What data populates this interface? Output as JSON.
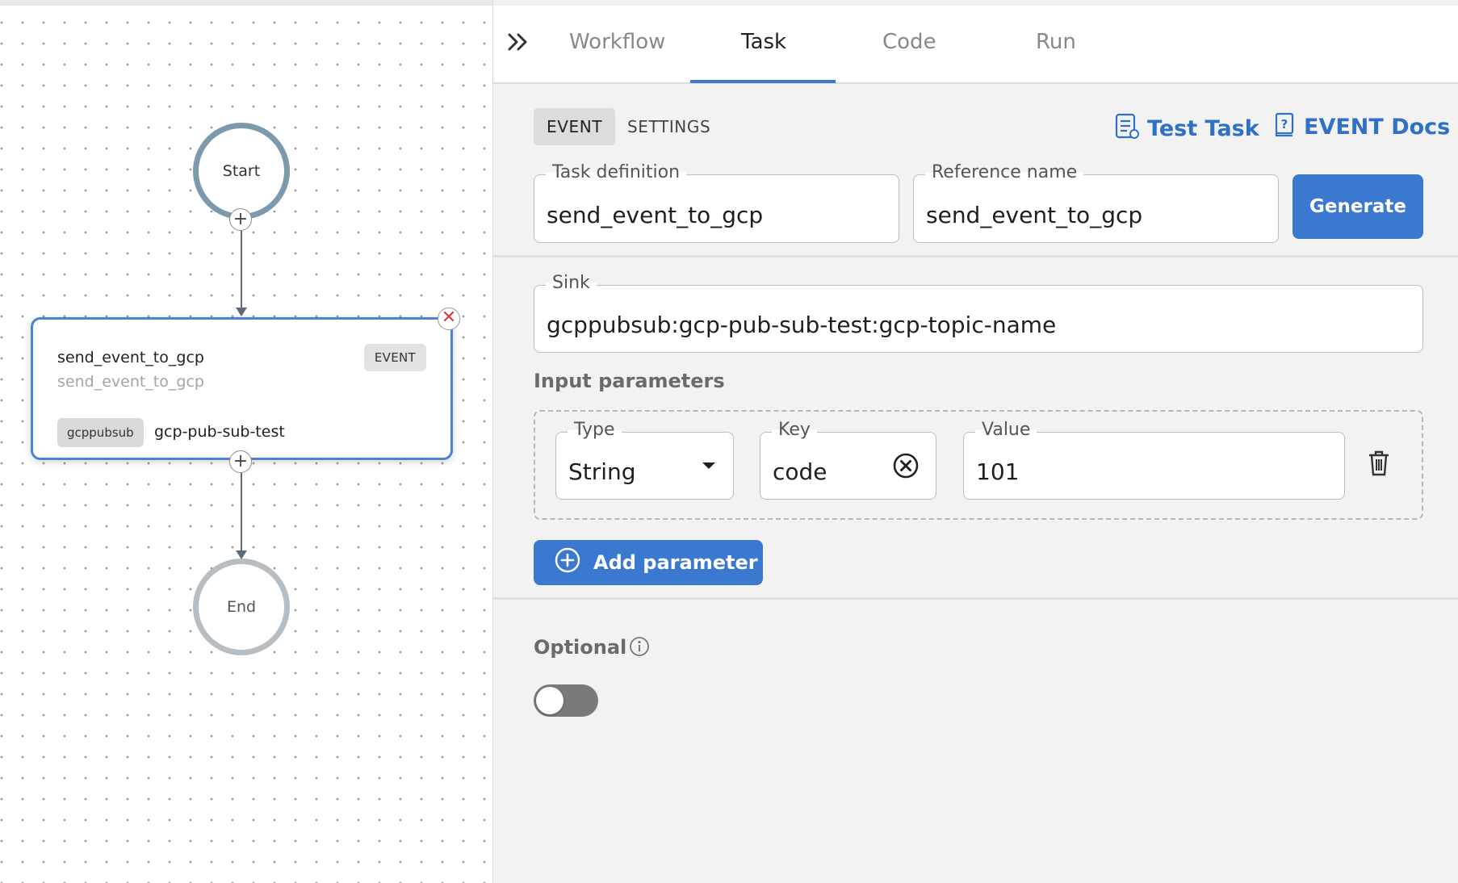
{
  "canvas": {
    "start_label": "Start",
    "end_label": "End",
    "task_node": {
      "name": "send_event_to_gcp",
      "reference": "send_event_to_gcp",
      "type_badge": "EVENT",
      "sink_chip": "gcppubsub",
      "sink_name": "gcp-pub-sub-test"
    },
    "plus_glyph": "+",
    "delete_glyph": "✕"
  },
  "panel": {
    "tabs": [
      {
        "label": "Workflow",
        "active": false
      },
      {
        "label": "Task",
        "active": true
      },
      {
        "label": "Code",
        "active": false
      },
      {
        "label": "Run",
        "active": false
      }
    ],
    "subtabs": [
      {
        "label": "EVENT",
        "active": true
      },
      {
        "label": "SETTINGS",
        "active": false
      }
    ],
    "links": {
      "test_task": "Test Task",
      "event_docs": "EVENT Docs"
    },
    "task_definition": {
      "label": "Task definition",
      "value": "send_event_to_gcp"
    },
    "reference_name": {
      "label": "Reference name",
      "value": "send_event_to_gcp"
    },
    "generate_button": "Generate",
    "sink": {
      "label": "Sink",
      "value": "gcppubsub:gcp-pub-sub-test:gcp-topic-name"
    },
    "input_parameters_title": "Input parameters",
    "parameter": {
      "type_label": "Type",
      "type_value": "String",
      "key_label": "Key",
      "key_value": "code",
      "value_label": "Value",
      "value_value": "101"
    },
    "add_parameter_button": "Add parameter",
    "optional_label": "Optional",
    "optional_enabled": false,
    "accent_color": "#3b78d0",
    "icons": [
      "chevron-double-right-icon",
      "checklist-icon",
      "docs-icon",
      "dropdown-caret-icon",
      "clear-circle-icon",
      "trash-icon",
      "plus-circle-icon",
      "info-icon"
    ]
  }
}
